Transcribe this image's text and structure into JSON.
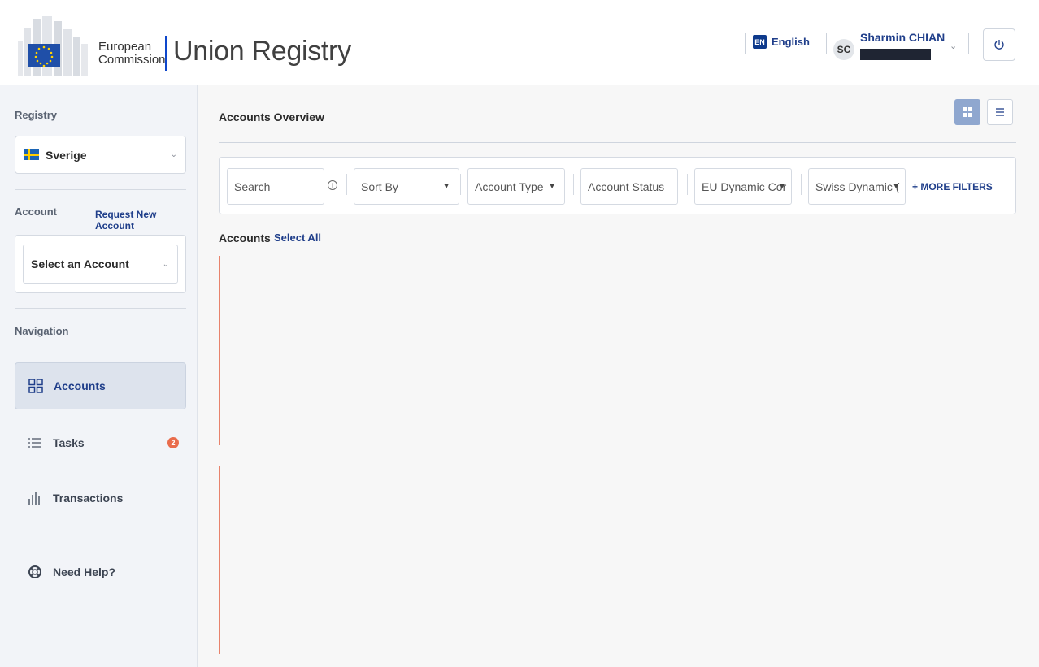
{
  "header": {
    "logo_line1": "European",
    "logo_line2": "Commission",
    "app_title": "Union Registry",
    "language_code": "EN",
    "language_label": "English",
    "user_initials": "SC",
    "user_name": "Sharmin CHIAN"
  },
  "sidebar": {
    "registry_label": "Registry",
    "registry_value": "Sverige",
    "account_label": "Account",
    "request_new_account": "Request New Account",
    "account_select_placeholder": "Select an Account",
    "navigation_label": "Navigation",
    "nav_items": [
      {
        "label": "Accounts",
        "icon": "grid-icon",
        "active": true
      },
      {
        "label": "Tasks",
        "icon": "list-icon",
        "badge": "2"
      },
      {
        "label": "Transactions",
        "icon": "bar-chart-icon"
      }
    ],
    "help_label": "Need Help?"
  },
  "main": {
    "title": "Accounts Overview",
    "filters": {
      "search_placeholder": "Search",
      "sort_by": "Sort By",
      "account_type": "Account Type",
      "account_status": "Account Status",
      "eu_dynamic": "EU Dynamic Cor",
      "swiss_dynamic": "Swiss Dynamic (",
      "more_filters": "+ MORE FILTERS"
    },
    "accounts_label": "Accounts",
    "select_all": "Select All"
  },
  "colors": {
    "brand_blue": "#1f3e8a",
    "accent_line": "#0e47cb",
    "badge": "#e96c4c",
    "sidebar_bg": "#f2f4f8",
    "main_bg": "#f7f7f7"
  }
}
